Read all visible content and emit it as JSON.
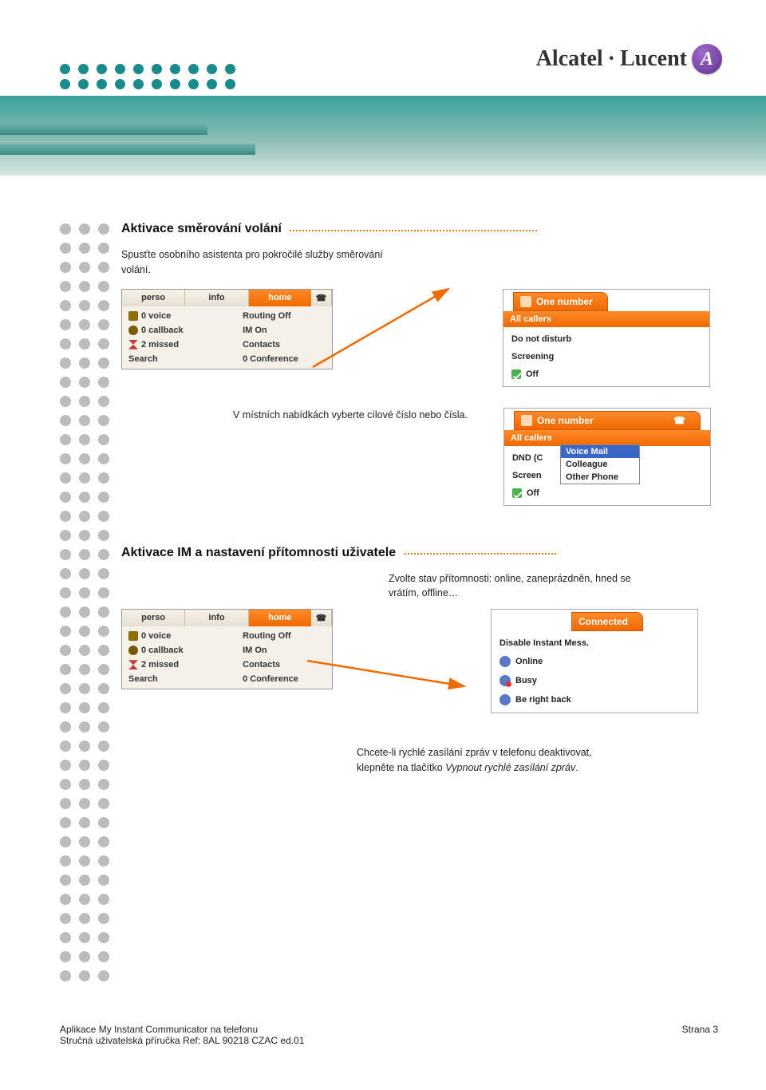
{
  "brand": {
    "name1": "Alcatel",
    "dot": "·",
    "name2": "Lucent",
    "badge": "A"
  },
  "section1": {
    "title": "Aktivace směrování volání",
    "intro": "Spusťte osobního asistenta pro pokročilé služby směrování volání.",
    "instr2": "V místních nabídkách vyberte cílové číslo nebo čísla."
  },
  "section2": {
    "title": "Aktivace IM a nastavení přítomnosti uživatele",
    "intro": "Zvolte stav přítomnosti: online, zaneprázdněn, hned se vrátím, offline…",
    "outro1": "Chcete-li rychlé zasílání zpráv v telefonu deaktivovat, klepněte na tlačítko ",
    "outro_em": "Vypnout rychlé zasílání zpráv",
    "outro2": "."
  },
  "phone": {
    "tabs": {
      "perso": "perso",
      "info": "info",
      "home": "home"
    },
    "rows": {
      "voice": "0 voice",
      "routing": "Routing Off",
      "callback": "0 callback",
      "im": "IM On",
      "missed": "2 missed",
      "contacts": "Contacts",
      "search": "Search",
      "conf": "0  Conference"
    }
  },
  "onenumber_panel": {
    "tab": "One number",
    "head": "All callers",
    "items": {
      "dnd": "Do not disturb",
      "screen": "Screening",
      "off": "Off"
    }
  },
  "onenumber_panel2": {
    "tab": "One number",
    "head": "All callers",
    "dnd_short": "DND (C",
    "screen_short": "Screen",
    "off": "Off",
    "dropdown": {
      "voicemail": "Voice Mail",
      "colleague": "Colleague",
      "other": "Other Phone"
    }
  },
  "connected_panel": {
    "tab": "Connected",
    "items": {
      "disable": "Disable Instant Mess.",
      "online": "Online",
      "busy": "Busy",
      "brb": "Be right back"
    }
  },
  "footer": {
    "title": "Aplikace My Instant Communicator na telefonu",
    "ref": "Stručná uživatelská příručka Ref: 8AL 90218 CZAC ed.01",
    "page": "Strana 3"
  }
}
